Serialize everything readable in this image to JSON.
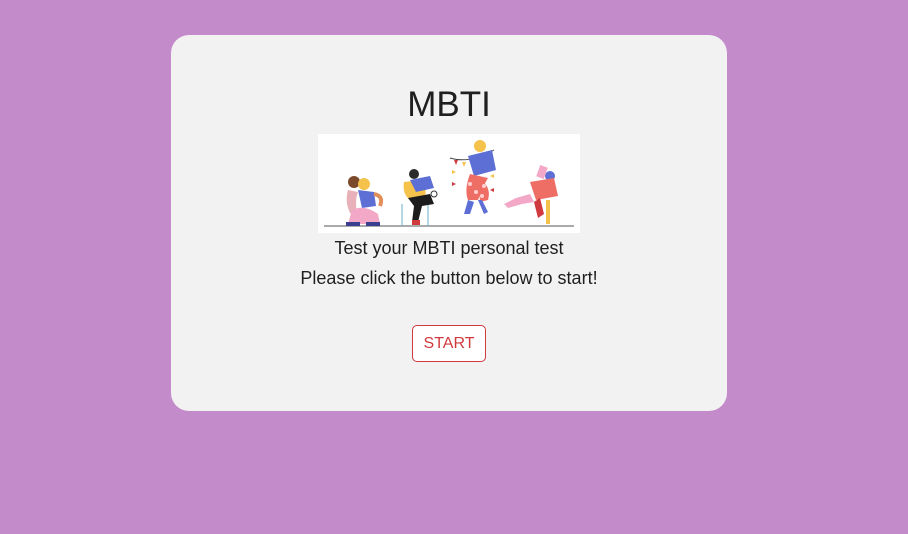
{
  "card": {
    "title": "MBTI",
    "illustration": "people-celebrating-illustration",
    "line1": "Test your MBTI personal test",
    "line2": "Please click the button below to start!",
    "start_label": "START"
  },
  "colors": {
    "background": "#c38bc9",
    "card": "#f2f2f2",
    "accent": "#d0393e",
    "text": "#1f1f1f"
  }
}
